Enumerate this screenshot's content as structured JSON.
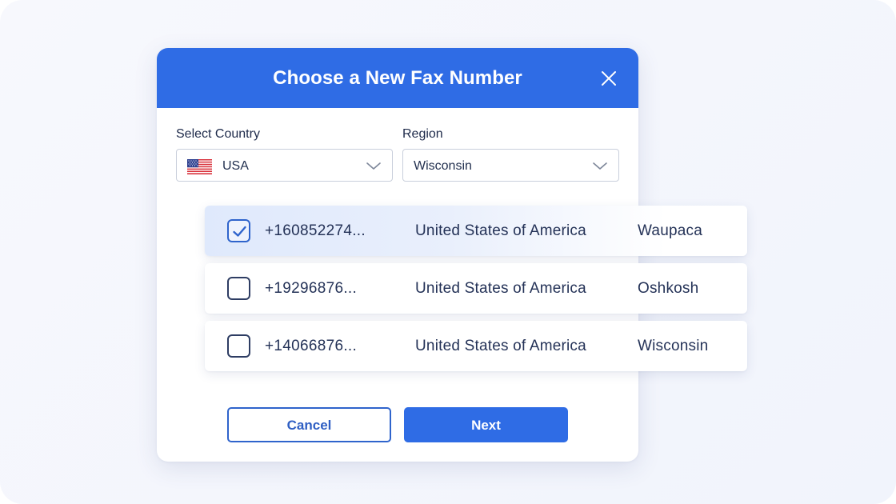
{
  "dialog": {
    "title": "Choose a New Fax Number"
  },
  "country": {
    "label": "Select Country",
    "value": "USA",
    "flag_icon": "us-flag-icon"
  },
  "region": {
    "label": "Region",
    "value": "Wisconsin"
  },
  "numbers": [
    {
      "number": "+160852274...",
      "country": "United States of America",
      "city": "Waupaca",
      "checked": true
    },
    {
      "number": "+19296876...",
      "country": "United States of America",
      "city": "Oshkosh",
      "checked": false
    },
    {
      "number": "+14066876...",
      "country": "United States of America",
      "city": "Wisconsin",
      "checked": false
    }
  ],
  "actions": {
    "cancel_label": "Cancel",
    "next_label": "Next"
  },
  "colors": {
    "primary": "#2f6ce5",
    "text": "#243257",
    "background": "#f4f6fc"
  }
}
